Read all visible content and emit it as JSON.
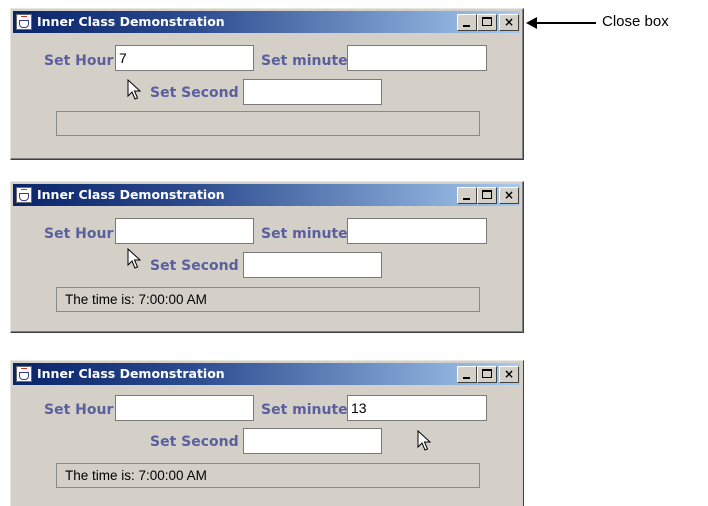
{
  "windows": [
    {
      "title": "Inner Class Demonstration",
      "labels": {
        "hour": "Set Hour",
        "minute": "Set minute",
        "second": "Set Second"
      },
      "fields": {
        "hour": "7",
        "minute": "",
        "second": ""
      },
      "status": "",
      "controls": {
        "minimize": "_",
        "maximize": "□",
        "close": "×"
      }
    },
    {
      "title": "Inner Class Demonstration",
      "labels": {
        "hour": "Set Hour",
        "minute": "Set minute",
        "second": "Set Second"
      },
      "fields": {
        "hour": "",
        "minute": "",
        "second": ""
      },
      "status": "The time is: 7:00:00 AM",
      "controls": {
        "minimize": "_",
        "maximize": "□",
        "close": "×"
      }
    },
    {
      "title": "Inner Class Demonstration",
      "labels": {
        "hour": "Set Hour",
        "minute": "Set minute",
        "second": "Set Second"
      },
      "fields": {
        "hour": "",
        "minute": "13",
        "second": ""
      },
      "status": "The time is: 7:00:00 AM",
      "controls": {
        "minimize": "_",
        "maximize": "□",
        "close": "×"
      }
    }
  ],
  "callout": {
    "text": "Close box"
  },
  "icons": {
    "app": "java-cup-icon",
    "pointer": "mouse-pointer-icon"
  },
  "colors": {
    "title_start": "#0a246a",
    "title_end": "#a6caf0",
    "label": "#5a5f9e",
    "window_bg": "#d4d0c8"
  }
}
